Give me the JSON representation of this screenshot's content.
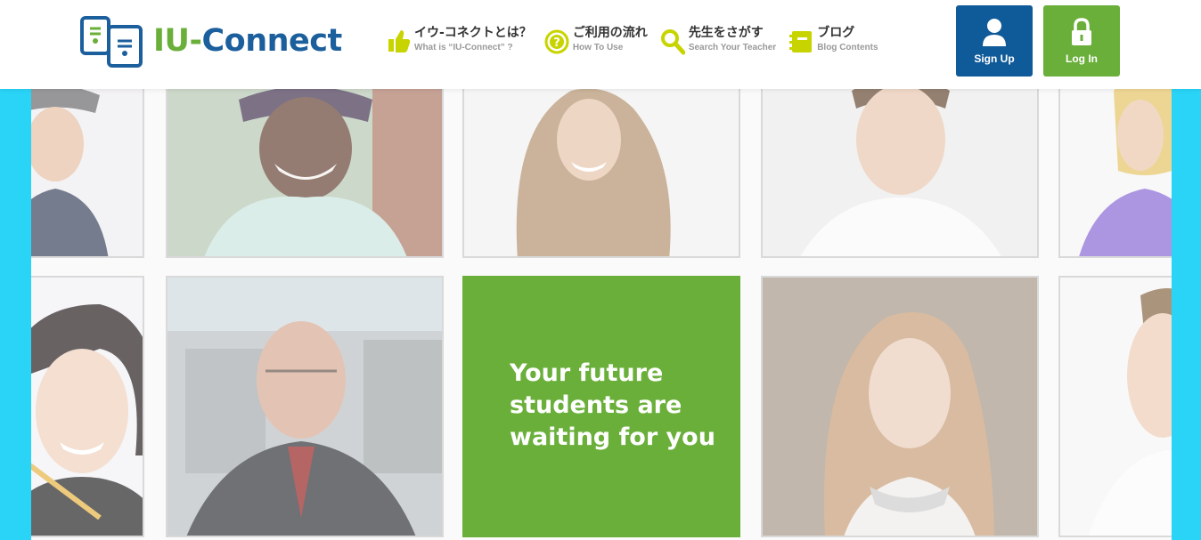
{
  "header": {
    "logo": {
      "prefix": "IU-",
      "suffix": "Connect"
    },
    "nav": [
      {
        "jp": "イウ-コネクトとは？",
        "en": "What is “IU-Connect” ?",
        "icon": "thumbs-up-icon"
      },
      {
        "jp": "ご利用の流れ",
        "en": "How To Use",
        "icon": "question-icon"
      },
      {
        "jp": "先生をさがす",
        "en": "Search Your Teacher",
        "icon": "search-icon"
      },
      {
        "jp": "ブログ",
        "en": "Blog Contents",
        "icon": "notebook-icon"
      }
    ],
    "signup_label": "Sign Up",
    "login_label": "Log In"
  },
  "hero": {
    "tagline": "Your future\nstudents are\nwaiting for you"
  },
  "colors": {
    "brand_blue": "#0f5a98",
    "brand_green": "#6aaf3a",
    "nav_icon_yellow": "#c8d400",
    "side_cyan": "#29d4f7"
  }
}
